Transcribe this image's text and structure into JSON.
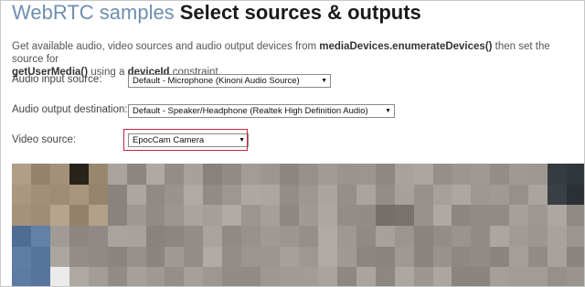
{
  "header": {
    "crumb": "WebRTC samples",
    "title": "Select sources & outputs"
  },
  "description": {
    "part1": "Get available audio, video sources and audio output devices from ",
    "api1": "mediaDevices.enumerateDevices()",
    "part2": " then set the source for ",
    "api2": "getUserMedia()",
    "part3": " using a ",
    "api3": "deviceId",
    "part4": " constraint."
  },
  "audio_input": {
    "label": "Audio input source:",
    "selected": "Default - Microphone (Kinoni Audio Source)"
  },
  "audio_output": {
    "label": "Audio output destination:",
    "selected": "Default - Speaker/Headphone (Realtek High Definition Audio)"
  },
  "video_source": {
    "label": "Video source:",
    "selected": "EpocCam Camera"
  },
  "icons": {
    "dropdown": "dropdown-arrow-icon"
  },
  "colors": {
    "crumb": "#6f8fb0",
    "highlight": "#c0283a"
  }
}
